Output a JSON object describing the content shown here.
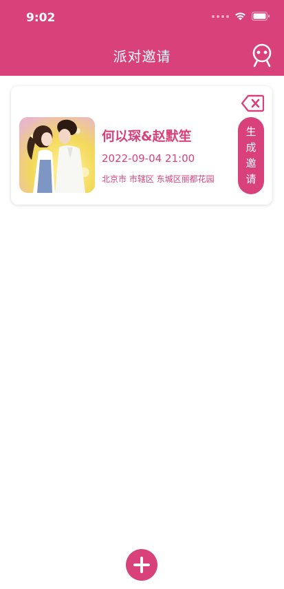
{
  "status_bar": {
    "time": "9:02"
  },
  "header": {
    "title": "派对邀请"
  },
  "card": {
    "name": "何以琛&赵默笙",
    "datetime": "2022-09-04 21:00",
    "address": "北京市 市辖区 东城区丽都花园",
    "generate_button": [
      "生",
      "成",
      "邀",
      "请"
    ]
  },
  "colors": {
    "accent": "#d9417b"
  },
  "icons": {
    "profile": "robot-face-icon",
    "delete": "backspace-icon",
    "add": "plus-icon"
  }
}
